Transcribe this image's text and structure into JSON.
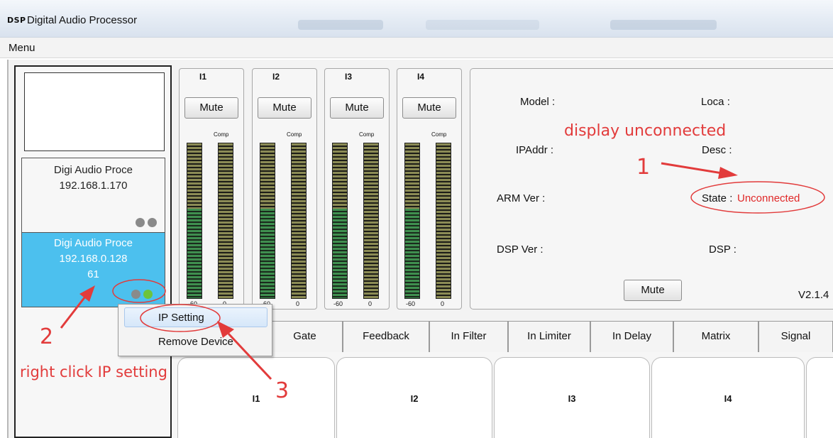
{
  "window": {
    "logo": "DSP",
    "title": "Digital Audio Processor"
  },
  "menubar": {
    "menu": "Menu"
  },
  "devices": [
    {
      "name": "Digi Audio Proce",
      "ip": "192.168.1.170",
      "extra": ""
    },
    {
      "name": "Digi Audio Proce",
      "ip": "192.168.0.128",
      "extra": "61"
    }
  ],
  "channels": [
    {
      "label": "I1",
      "mute": "Mute",
      "comp": "Comp",
      "tick_left": "-60",
      "tick_right": "0"
    },
    {
      "label": "I2",
      "mute": "Mute",
      "comp": "Comp",
      "tick_left": "-60",
      "tick_right": "0"
    },
    {
      "label": "I3",
      "mute": "Mute",
      "comp": "Comp",
      "tick_left": "-60",
      "tick_right": "0"
    },
    {
      "label": "I4",
      "mute": "Mute",
      "comp": "Comp",
      "tick_left": "-60",
      "tick_right": "0"
    }
  ],
  "info": {
    "model_label": "Model :",
    "ipaddr_label": "IPAddr :",
    "arm_label": "ARM Ver :",
    "dsp_ver_label": "DSP Ver :",
    "loca_label": "Loca :",
    "desc_label": "Desc :",
    "state_label": "State :",
    "state_value": "Unconnected",
    "dsp_label": "DSP :",
    "mute": "Mute",
    "version": "V2.1.4"
  },
  "tabs": [
    "Gate",
    "Feedback",
    "In Filter",
    "In Limiter",
    "In Delay",
    "Matrix",
    "Signal"
  ],
  "cards": [
    "I1",
    "I2",
    "I3",
    "I4"
  ],
  "context_menu": {
    "items": [
      "IP Setting",
      "Remove Device"
    ]
  },
  "annotations": {
    "display_unconnected": "display unconnected",
    "step1": "1",
    "step2": "2",
    "step3": "3",
    "right_click": "right click IP setting"
  },
  "colors": {
    "selected_device": "#4cc0ee",
    "annotation": "#e23b3b",
    "status_gray": "#8a8a8a",
    "status_green": "#6cc43c"
  }
}
